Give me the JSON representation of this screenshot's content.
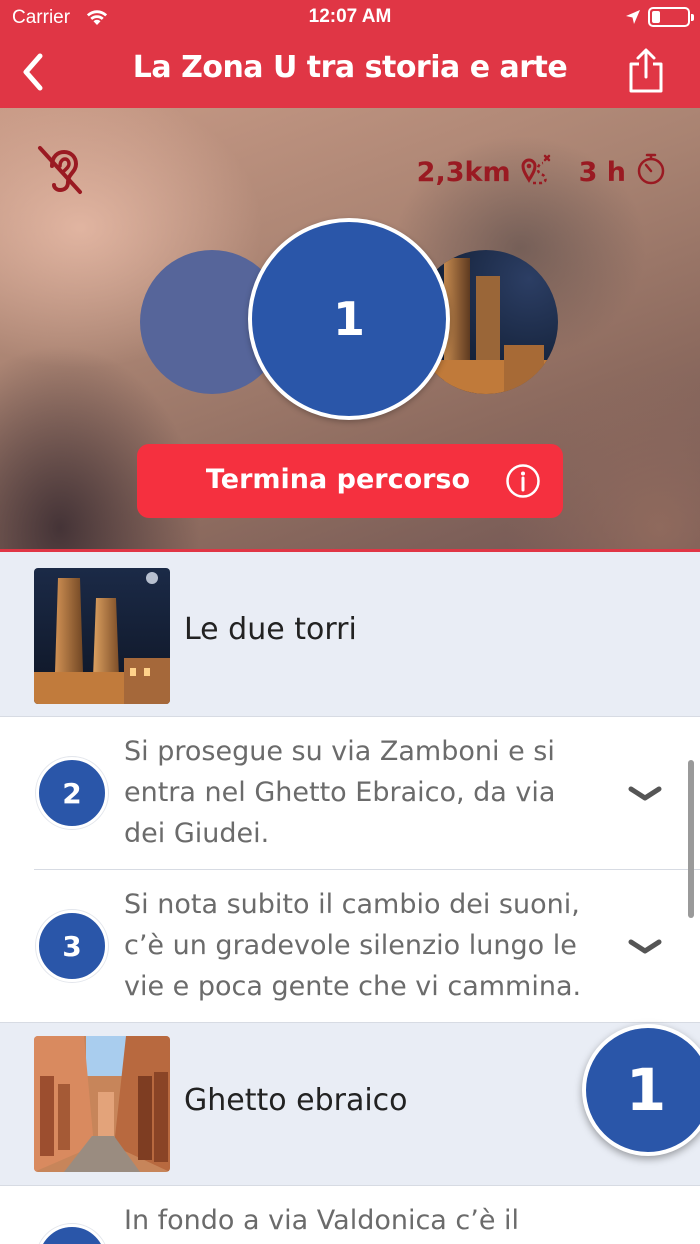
{
  "status_bar": {
    "carrier": "Carrier",
    "time": "12:07 AM",
    "icons": [
      "wifi-icon",
      "location-arrow-icon",
      "battery-icon"
    ]
  },
  "nav": {
    "title": "La Zona U tra storia e arte",
    "back_icon": "chevron-left-icon",
    "share_icon": "share-icon",
    "bar_color": "#e03645"
  },
  "hero": {
    "audio_icon": "hearing-disabled-icon",
    "distance": "2,3km",
    "distance_icon": "route-icon",
    "duration": "3 h",
    "duration_icon": "timer-icon",
    "current_stop": "1",
    "end_button_label": "Termina percorso",
    "end_button_icon": "info-icon",
    "accent_color": "#f5303f",
    "stop_color": "#2a56a9"
  },
  "list": {
    "items": [
      {
        "type": "poi",
        "title": "Le due torri",
        "image": "towers-photo"
      },
      {
        "type": "step",
        "number": "2",
        "text": "Si prosegue su via Zamboni e si entra nel Ghetto Ebraico, da via dei Giudei."
      },
      {
        "type": "step",
        "number": "3",
        "text": "Si nota subito il cambio dei suoni, c’è un gradevole silenzio lungo le vie e poca gente che vi cammina."
      },
      {
        "type": "poi",
        "title": "Ghetto ebraico",
        "image": "ghetto-street-photo"
      },
      {
        "type": "step",
        "number": "",
        "text": "In fondo a via Valdonica c’è il"
      }
    ]
  },
  "floating_stop_number": "1"
}
